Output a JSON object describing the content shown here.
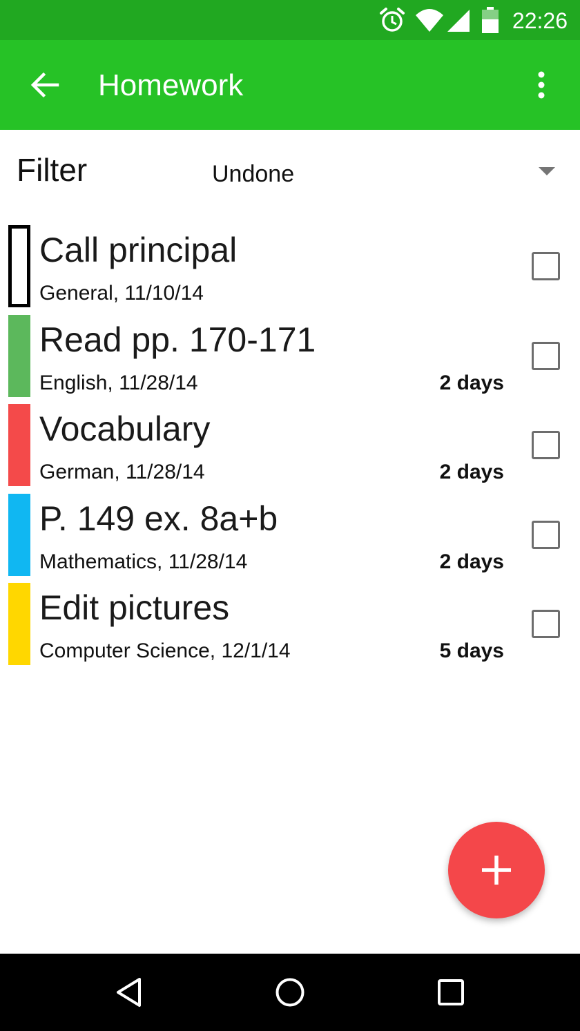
{
  "status_bar": {
    "time": "22:26",
    "icons": [
      "alarm-icon",
      "wifi-icon",
      "signal-icon",
      "battery-icon"
    ]
  },
  "app_bar": {
    "back_icon": "arrow-back-icon",
    "title": "Homework",
    "overflow_icon": "more-vert-icon"
  },
  "filter": {
    "label": "Filter",
    "selected": "Undone"
  },
  "homework": [
    {
      "title": "Call principal",
      "subtitle": "General, 11/10/14",
      "due": "",
      "color": "#ffffff",
      "outlined": true,
      "checked": false
    },
    {
      "title": "Read pp. 170-171",
      "subtitle": "English, 11/28/14",
      "due": "2 days",
      "color": "#5cb85c",
      "outlined": false,
      "checked": false
    },
    {
      "title": "Vocabulary",
      "subtitle": "German, 11/28/14",
      "due": "2 days",
      "color": "#f44a4a",
      "outlined": false,
      "checked": false
    },
    {
      "title": "P. 149 ex. 8a+b",
      "subtitle": "Mathematics, 11/28/14",
      "due": "2 days",
      "color": "#10b7f2",
      "outlined": false,
      "checked": false
    },
    {
      "title": "Edit pictures",
      "subtitle": "Computer Science, 12/1/14",
      "due": "5 days",
      "color": "#ffd700",
      "outlined": false,
      "checked": false
    }
  ],
  "fab": {
    "icon": "plus-icon",
    "color": "#f4474a"
  },
  "nav_bar": {
    "icons": [
      "back-triangle-icon",
      "home-circle-icon",
      "recents-square-icon"
    ]
  },
  "colors": {
    "status_bar": "#21a821",
    "app_bar": "#26c226"
  }
}
